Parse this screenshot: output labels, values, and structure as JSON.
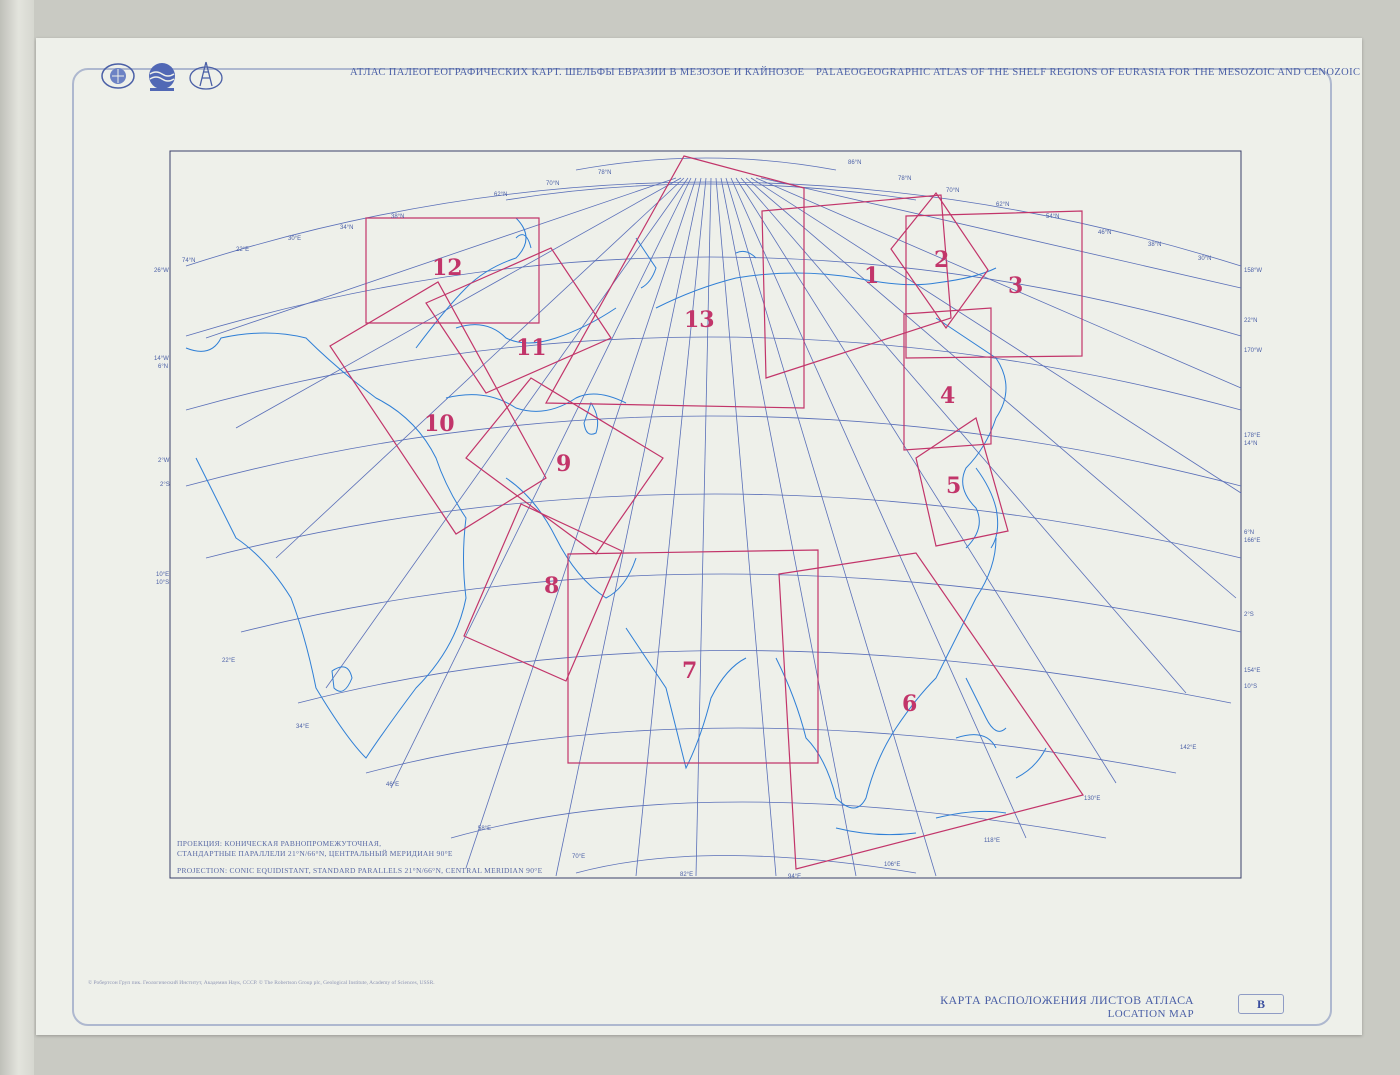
{
  "header": {
    "title_ru": "АТЛАС ПАЛЕОГЕОГРАФИЧЕСКИХ КАРТ.   ШЕЛЬФЫ ЕВРАЗИИ В МЕЗОЗОЕ И КАЙНОЗОЕ",
    "title_en": "PALAEOGEOGRAPHIC ATLAS OF THE SHELF REGIONS OF EURASIA FOR THE MESOZOIC AND CENOZOIC",
    "logos": [
      "globe-emblem-icon",
      "ocean-globe-emblem-icon",
      "oil-derrick-emblem-icon"
    ]
  },
  "projection": {
    "ru_line1": "ПРОЕКЦИЯ: КОНИЧЕСКАЯ РАВНОПРОМЕЖУТОЧНАЯ,",
    "ru_line2": "СТАНДАРТНЫЕ ПАРАЛЛЕЛИ 21°N/66°N, ЦЕНТРАЛЬНЫЙ МЕРИДИАН 90°E",
    "en": "PROJECTION: CONIC EQUIDISTANT, STANDARD PARALLELS 21°N/66°N, CENTRAL MERIDIAN 90°E"
  },
  "copyright": "© Робертсон Груп пик. Геологический Институт, Академия Наук, СССР.  © The Robertson Group plc, Geological Institute, Academy of Sciences, USSR.",
  "footer": {
    "location_ru": "КАРТА РАСПОЛОЖЕНИЯ ЛИСТОВ АТЛАСА",
    "location_en": "LOCATION MAP",
    "sheet_letter": "B"
  },
  "map": {
    "sheet_numbers": [
      "1",
      "2",
      "3",
      "4",
      "5",
      "6",
      "7",
      "8",
      "9",
      "10",
      "11",
      "12",
      "13"
    ],
    "grid_labels": {
      "top": [
        "74°N",
        "22°E",
        "30°E",
        "34°N",
        "38°N",
        "62°N",
        "70°N",
        "78°N",
        "86°N",
        "78°N",
        "70°N",
        "62°N",
        "54°N",
        "46°N",
        "38°N",
        "30°N"
      ],
      "left": [
        "26°W",
        "14°W",
        "6°N",
        "2°W",
        "2°S",
        "10°E",
        "10°S",
        "22°E",
        "34°E",
        "46°E",
        "58°E",
        "70°E",
        "82°E",
        "94°E"
      ],
      "right": [
        "158°W",
        "22°N",
        "170°W",
        "178°E",
        "14°N",
        "6°N",
        "166°E",
        "2°S",
        "154°E",
        "10°S",
        "142°E",
        "130°E",
        "118°E",
        "106°E"
      ]
    },
    "colors": {
      "graticule": "#5a6fb8",
      "coast": "#2f7fd6",
      "sheet_outline": "#c2356a",
      "frame": "#3a3f6a"
    }
  }
}
